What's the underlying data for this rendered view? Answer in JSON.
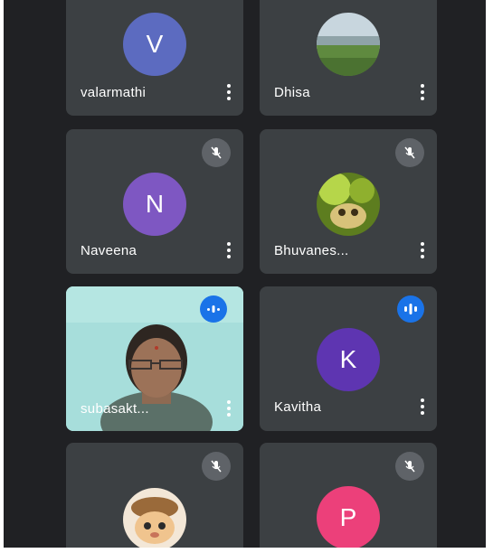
{
  "participants": [
    {
      "name": "valarmathi",
      "initial": "V",
      "avatar_color": "#5c6bc0",
      "mic": "none"
    },
    {
      "name": "Dhisa",
      "initial": "",
      "avatar_color": "#7f9a8a",
      "mic": "none"
    },
    {
      "name": "Naveena",
      "initial": "N",
      "avatar_color": "#7e57c2",
      "mic": "muted"
    },
    {
      "name": "Bhuvanes...",
      "initial": "",
      "avatar_color": "#6f8f2f",
      "mic": "muted"
    },
    {
      "name": "subasakt...",
      "initial": "",
      "avatar_color": "#9fd8d8",
      "mic": "speaking"
    },
    {
      "name": "Kavitha",
      "initial": "K",
      "avatar_color": "#5e35b1",
      "mic": "speaking"
    },
    {
      "name": "",
      "initial": "",
      "avatar_color": "#d9a36b",
      "mic": "muted"
    },
    {
      "name": "",
      "initial": "P",
      "avatar_color": "#ec407a",
      "mic": "muted"
    }
  ],
  "colors": {
    "background": "#202124",
    "tile": "#3c4043",
    "muted_badge": "#5f6368",
    "speaking_badge": "#1a73e8"
  },
  "icons": {
    "muted": "mic-off-icon",
    "speaking": "audio-wave-icon",
    "more": "more-vert-icon"
  }
}
